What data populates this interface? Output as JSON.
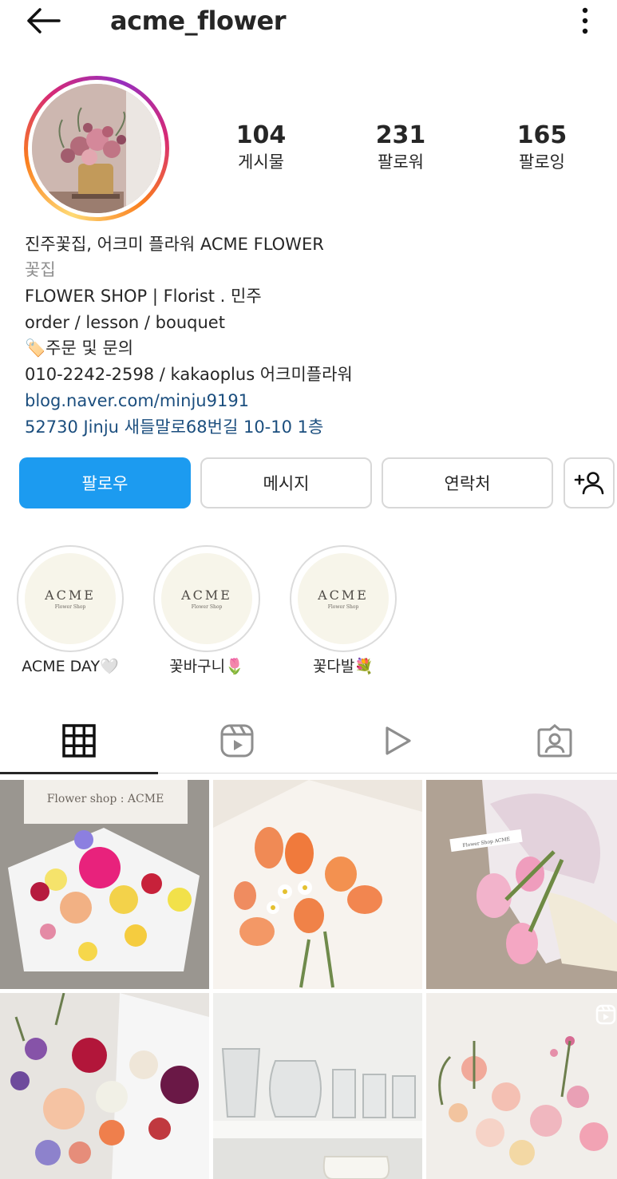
{
  "header": {
    "title": "acme_flower",
    "back_icon": "arrow-left-icon",
    "more_icon": "more-vertical-icon"
  },
  "profile": {
    "stats": [
      {
        "value": "104",
        "label": "게시물"
      },
      {
        "value": "231",
        "label": "팔로워"
      },
      {
        "value": "165",
        "label": "팔로잉"
      }
    ],
    "name": "진주꽃집, 어크미 플라워 ACME FLOWER",
    "category": "꽃집",
    "bio_lines": [
      "FLOWER SHOP  |  Florist . 민주",
      "order / lesson / bouquet",
      "🏷️주문 및 문의",
      "010-2242-2598 / kakaoplus 어크미플라워"
    ],
    "website": "blog.naver.com/minju9191",
    "address": "52730 Jinju 새들말로68번길 10-10 1층"
  },
  "buttons": {
    "follow": "팔로우",
    "message": "메시지",
    "contact": "연락처",
    "suggest_icon": "add-user-icon"
  },
  "highlights": [
    {
      "brand": "ACME",
      "sub": "Flower Shop",
      "label": "ACME DAY🤍"
    },
    {
      "brand": "ACME",
      "sub": "Flower Shop",
      "label": "꽃바구니🌷"
    },
    {
      "brand": "ACME",
      "sub": "Flower Shop",
      "label": "꽃다발💐"
    }
  ],
  "tabs": [
    {
      "name": "grid",
      "icon": "grid-icon",
      "active": true
    },
    {
      "name": "reels",
      "icon": "reels-icon"
    },
    {
      "name": "video",
      "icon": "play-icon"
    },
    {
      "name": "tagged",
      "icon": "tagged-user-icon"
    }
  ],
  "posts": [
    {
      "sign": "Flower shop : ACME",
      "desc": "colorful bouquet in white wrap"
    },
    {
      "desc": "orange tulip bouquet"
    },
    {
      "tag": "Flower Shop ACME",
      "desc": "pink tulip bouquet"
    },
    {
      "desc": "purple and red flower arrangement"
    },
    {
      "desc": "glass vases on shelf"
    },
    {
      "desc": "pink flower basket",
      "icon": "reels-badge-icon"
    }
  ],
  "colors": {
    "accent": "#1c9bf0",
    "link": "#1b4e7e",
    "text": "#262626",
    "muted": "#8e8e8e"
  }
}
